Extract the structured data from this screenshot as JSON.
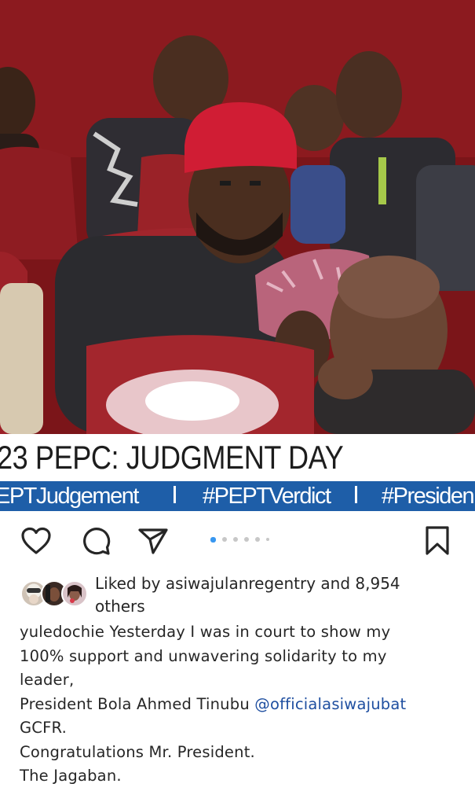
{
  "post": {
    "news_headline": "23 PEPC: JUDGMENT DAY",
    "ticker": [
      "EPTJudgement",
      "#PEPTVerdict",
      "#Presiden"
    ]
  },
  "actions": {
    "like_icon": "heart-icon",
    "comment_icon": "comment-icon",
    "share_icon": "send-icon",
    "save_icon": "bookmark-icon",
    "carousel_count": 6,
    "carousel_active_index": 0
  },
  "likes": {
    "line1": "Liked by asiwajulanregentry and 8,954",
    "line2": "others"
  },
  "caption": {
    "line1": "yuledochie Yesterday I was in court to show my",
    "line2": "100% support and unwavering solidarity to my",
    "line3": "leader,",
    "line4_text": "President Bola Ahmed Tinubu ",
    "line4_mention": "@officialasiwajubat",
    "line5": "GCFR.",
    "line6": "Congratulations Mr. President.",
    "line7": "The Jagaban."
  },
  "colors": {
    "accent": "#3897f0",
    "ticker_bg": "#1e5ea8",
    "mention": "#1f4fa0",
    "text": "#262626"
  }
}
